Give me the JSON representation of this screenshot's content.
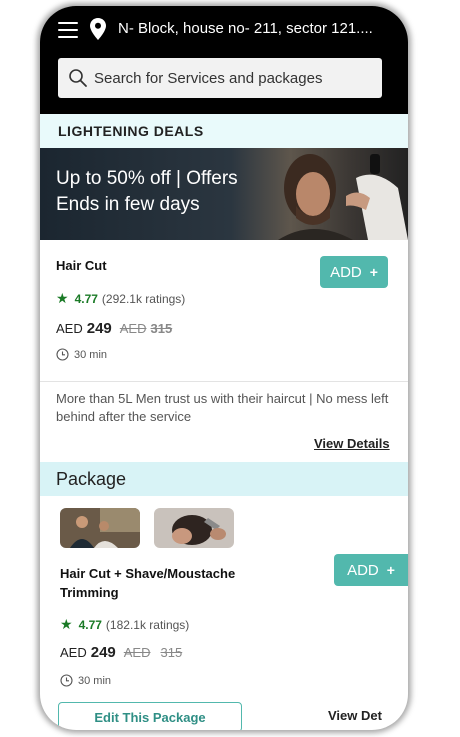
{
  "header": {
    "address": "N- Block, house no- 211, sector 121....",
    "search_placeholder": "Search for Services and packages"
  },
  "deals": {
    "section_title": "LIGHTENING DEALS",
    "banner_line1": "Up to 50% off | Offers",
    "banner_line2": "Ends in few days"
  },
  "service": {
    "name": "Hair Cut",
    "add_label": "ADD",
    "rating_value": "4.77",
    "rating_count": "(292.1k  ratings)",
    "currency": "AED",
    "price": "249",
    "old_currency": "AED",
    "old_price": "315",
    "duration": "30 min",
    "description": "More than 5L Men trust us with their haircut | No mess left behind after the service",
    "view_details": "View Details"
  },
  "package": {
    "section_title": "Package",
    "name": "Hair Cut + Shave/Moustache Trimming",
    "add_label": "ADD",
    "rating_value": "4.77",
    "rating_count": "(182.1k  ratings)",
    "currency": "AED",
    "price": "249",
    "old_currency": "AED",
    "old_price": "315",
    "duration": "30 min",
    "edit_label": "Edit This Package",
    "view_details": "View Det"
  },
  "colors": {
    "accent": "#52b8ad",
    "rating_green": "#1a7a26",
    "deals_bg": "#e9fafb",
    "package_bg": "#d8f3f6"
  },
  "icons": [
    "menu-icon",
    "location-pin-icon",
    "search-icon",
    "star-icon",
    "clock-icon",
    "plus-icon"
  ]
}
